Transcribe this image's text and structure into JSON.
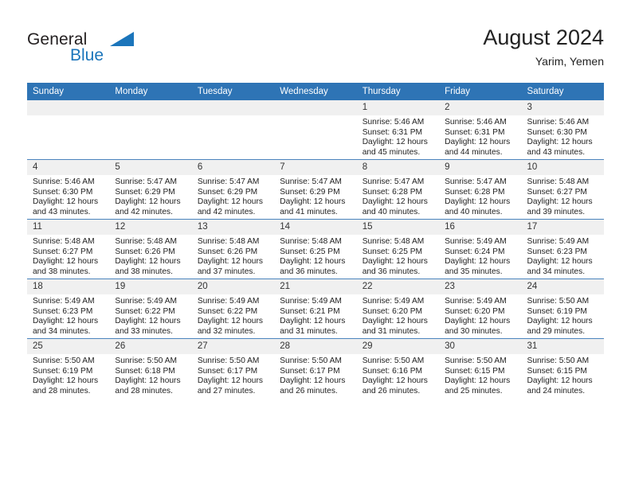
{
  "brand": {
    "line1": "General",
    "line2": "Blue",
    "triangle_color": "#1b75bb"
  },
  "header": {
    "month_title": "August 2024",
    "location": "Yarim, Yemen",
    "header_bg": "#2e74b5",
    "daynum_bg": "#f0f0f0"
  },
  "weekday_headers": [
    "Sunday",
    "Monday",
    "Tuesday",
    "Wednesday",
    "Thursday",
    "Friday",
    "Saturday"
  ],
  "weeks": [
    [
      {
        "day": "",
        "empty": true,
        "sunrise": "",
        "sunset": "",
        "daylight1": "",
        "daylight2": ""
      },
      {
        "day": "",
        "empty": true,
        "sunrise": "",
        "sunset": "",
        "daylight1": "",
        "daylight2": ""
      },
      {
        "day": "",
        "empty": true,
        "sunrise": "",
        "sunset": "",
        "daylight1": "",
        "daylight2": ""
      },
      {
        "day": "",
        "empty": true,
        "sunrise": "",
        "sunset": "",
        "daylight1": "",
        "daylight2": ""
      },
      {
        "day": "1",
        "empty": false,
        "sunrise": "Sunrise: 5:46 AM",
        "sunset": "Sunset: 6:31 PM",
        "daylight1": "Daylight: 12 hours",
        "daylight2": "and 45 minutes."
      },
      {
        "day": "2",
        "empty": false,
        "sunrise": "Sunrise: 5:46 AM",
        "sunset": "Sunset: 6:31 PM",
        "daylight1": "Daylight: 12 hours",
        "daylight2": "and 44 minutes."
      },
      {
        "day": "3",
        "empty": false,
        "sunrise": "Sunrise: 5:46 AM",
        "sunset": "Sunset: 6:30 PM",
        "daylight1": "Daylight: 12 hours",
        "daylight2": "and 43 minutes."
      }
    ],
    [
      {
        "day": "4",
        "empty": false,
        "sunrise": "Sunrise: 5:46 AM",
        "sunset": "Sunset: 6:30 PM",
        "daylight1": "Daylight: 12 hours",
        "daylight2": "and 43 minutes."
      },
      {
        "day": "5",
        "empty": false,
        "sunrise": "Sunrise: 5:47 AM",
        "sunset": "Sunset: 6:29 PM",
        "daylight1": "Daylight: 12 hours",
        "daylight2": "and 42 minutes."
      },
      {
        "day": "6",
        "empty": false,
        "sunrise": "Sunrise: 5:47 AM",
        "sunset": "Sunset: 6:29 PM",
        "daylight1": "Daylight: 12 hours",
        "daylight2": "and 42 minutes."
      },
      {
        "day": "7",
        "empty": false,
        "sunrise": "Sunrise: 5:47 AM",
        "sunset": "Sunset: 6:29 PM",
        "daylight1": "Daylight: 12 hours",
        "daylight2": "and 41 minutes."
      },
      {
        "day": "8",
        "empty": false,
        "sunrise": "Sunrise: 5:47 AM",
        "sunset": "Sunset: 6:28 PM",
        "daylight1": "Daylight: 12 hours",
        "daylight2": "and 40 minutes."
      },
      {
        "day": "9",
        "empty": false,
        "sunrise": "Sunrise: 5:47 AM",
        "sunset": "Sunset: 6:28 PM",
        "daylight1": "Daylight: 12 hours",
        "daylight2": "and 40 minutes."
      },
      {
        "day": "10",
        "empty": false,
        "sunrise": "Sunrise: 5:48 AM",
        "sunset": "Sunset: 6:27 PM",
        "daylight1": "Daylight: 12 hours",
        "daylight2": "and 39 minutes."
      }
    ],
    [
      {
        "day": "11",
        "empty": false,
        "sunrise": "Sunrise: 5:48 AM",
        "sunset": "Sunset: 6:27 PM",
        "daylight1": "Daylight: 12 hours",
        "daylight2": "and 38 minutes."
      },
      {
        "day": "12",
        "empty": false,
        "sunrise": "Sunrise: 5:48 AM",
        "sunset": "Sunset: 6:26 PM",
        "daylight1": "Daylight: 12 hours",
        "daylight2": "and 38 minutes."
      },
      {
        "day": "13",
        "empty": false,
        "sunrise": "Sunrise: 5:48 AM",
        "sunset": "Sunset: 6:26 PM",
        "daylight1": "Daylight: 12 hours",
        "daylight2": "and 37 minutes."
      },
      {
        "day": "14",
        "empty": false,
        "sunrise": "Sunrise: 5:48 AM",
        "sunset": "Sunset: 6:25 PM",
        "daylight1": "Daylight: 12 hours",
        "daylight2": "and 36 minutes."
      },
      {
        "day": "15",
        "empty": false,
        "sunrise": "Sunrise: 5:48 AM",
        "sunset": "Sunset: 6:25 PM",
        "daylight1": "Daylight: 12 hours",
        "daylight2": "and 36 minutes."
      },
      {
        "day": "16",
        "empty": false,
        "sunrise": "Sunrise: 5:49 AM",
        "sunset": "Sunset: 6:24 PM",
        "daylight1": "Daylight: 12 hours",
        "daylight2": "and 35 minutes."
      },
      {
        "day": "17",
        "empty": false,
        "sunrise": "Sunrise: 5:49 AM",
        "sunset": "Sunset: 6:23 PM",
        "daylight1": "Daylight: 12 hours",
        "daylight2": "and 34 minutes."
      }
    ],
    [
      {
        "day": "18",
        "empty": false,
        "sunrise": "Sunrise: 5:49 AM",
        "sunset": "Sunset: 6:23 PM",
        "daylight1": "Daylight: 12 hours",
        "daylight2": "and 34 minutes."
      },
      {
        "day": "19",
        "empty": false,
        "sunrise": "Sunrise: 5:49 AM",
        "sunset": "Sunset: 6:22 PM",
        "daylight1": "Daylight: 12 hours",
        "daylight2": "and 33 minutes."
      },
      {
        "day": "20",
        "empty": false,
        "sunrise": "Sunrise: 5:49 AM",
        "sunset": "Sunset: 6:22 PM",
        "daylight1": "Daylight: 12 hours",
        "daylight2": "and 32 minutes."
      },
      {
        "day": "21",
        "empty": false,
        "sunrise": "Sunrise: 5:49 AM",
        "sunset": "Sunset: 6:21 PM",
        "daylight1": "Daylight: 12 hours",
        "daylight2": "and 31 minutes."
      },
      {
        "day": "22",
        "empty": false,
        "sunrise": "Sunrise: 5:49 AM",
        "sunset": "Sunset: 6:20 PM",
        "daylight1": "Daylight: 12 hours",
        "daylight2": "and 31 minutes."
      },
      {
        "day": "23",
        "empty": false,
        "sunrise": "Sunrise: 5:49 AM",
        "sunset": "Sunset: 6:20 PM",
        "daylight1": "Daylight: 12 hours",
        "daylight2": "and 30 minutes."
      },
      {
        "day": "24",
        "empty": false,
        "sunrise": "Sunrise: 5:50 AM",
        "sunset": "Sunset: 6:19 PM",
        "daylight1": "Daylight: 12 hours",
        "daylight2": "and 29 minutes."
      }
    ],
    [
      {
        "day": "25",
        "empty": false,
        "sunrise": "Sunrise: 5:50 AM",
        "sunset": "Sunset: 6:19 PM",
        "daylight1": "Daylight: 12 hours",
        "daylight2": "and 28 minutes."
      },
      {
        "day": "26",
        "empty": false,
        "sunrise": "Sunrise: 5:50 AM",
        "sunset": "Sunset: 6:18 PM",
        "daylight1": "Daylight: 12 hours",
        "daylight2": "and 28 minutes."
      },
      {
        "day": "27",
        "empty": false,
        "sunrise": "Sunrise: 5:50 AM",
        "sunset": "Sunset: 6:17 PM",
        "daylight1": "Daylight: 12 hours",
        "daylight2": "and 27 minutes."
      },
      {
        "day": "28",
        "empty": false,
        "sunrise": "Sunrise: 5:50 AM",
        "sunset": "Sunset: 6:17 PM",
        "daylight1": "Daylight: 12 hours",
        "daylight2": "and 26 minutes."
      },
      {
        "day": "29",
        "empty": false,
        "sunrise": "Sunrise: 5:50 AM",
        "sunset": "Sunset: 6:16 PM",
        "daylight1": "Daylight: 12 hours",
        "daylight2": "and 26 minutes."
      },
      {
        "day": "30",
        "empty": false,
        "sunrise": "Sunrise: 5:50 AM",
        "sunset": "Sunset: 6:15 PM",
        "daylight1": "Daylight: 12 hours",
        "daylight2": "and 25 minutes."
      },
      {
        "day": "31",
        "empty": false,
        "sunrise": "Sunrise: 5:50 AM",
        "sunset": "Sunset: 6:15 PM",
        "daylight1": "Daylight: 12 hours",
        "daylight2": "and 24 minutes."
      }
    ]
  ]
}
